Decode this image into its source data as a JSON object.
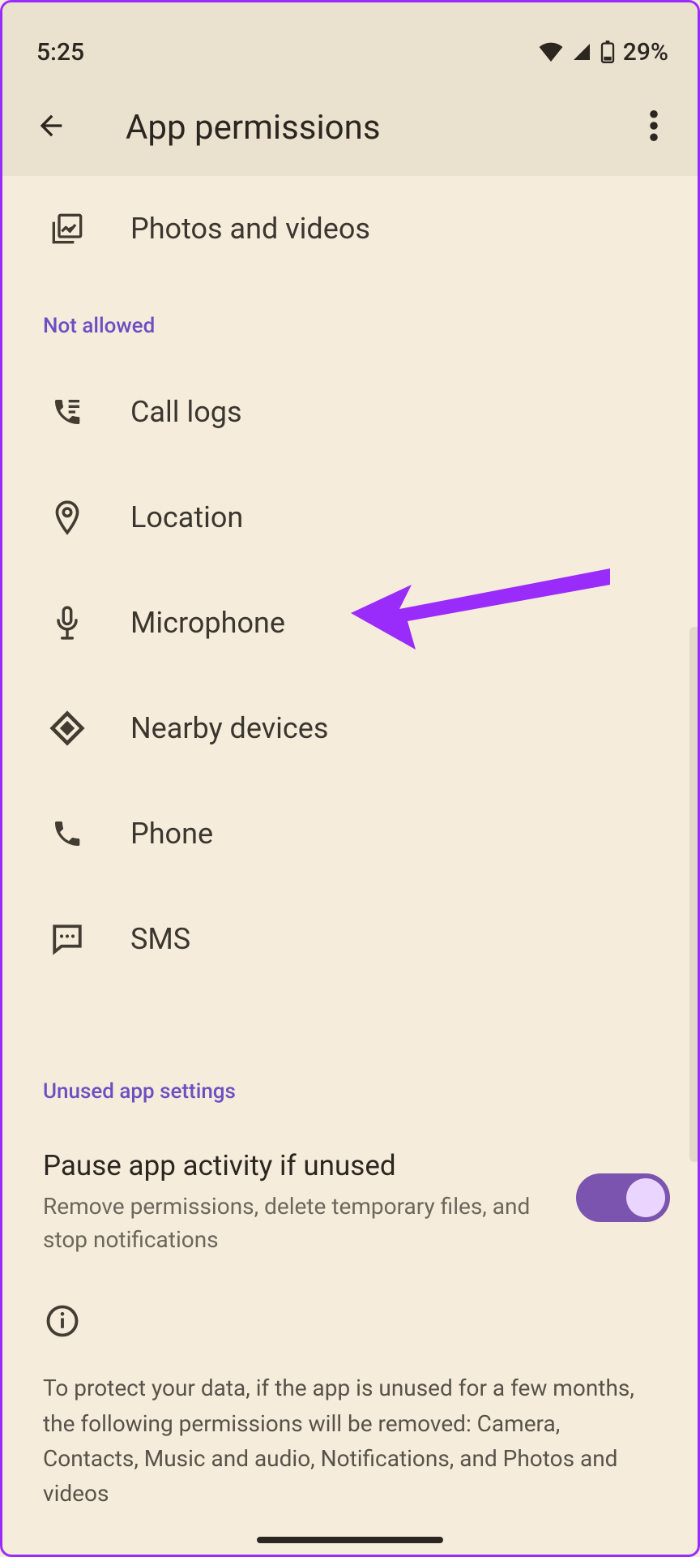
{
  "statusbar": {
    "time": "5:25",
    "battery_text": "29%"
  },
  "appbar": {
    "title": "App permissions"
  },
  "allowed_trailing": {
    "photos_videos": "Photos and videos"
  },
  "section_not_allowed": "Not allowed",
  "not_allowed": {
    "call_logs": "Call logs",
    "location": "Location",
    "microphone": "Microphone",
    "nearby_devices": "Nearby devices",
    "phone": "Phone",
    "sms": "SMS"
  },
  "section_unused": "Unused app settings",
  "pause": {
    "title": "Pause app activity if unused",
    "subtitle": "Remove permissions, delete temporary files, and stop notifications",
    "on": true
  },
  "info_text": "To protect your data, if the app is unused for a few months, the following permissions will be removed: Camera, Contacts, Music and audio, Notifications, and Photos and videos"
}
